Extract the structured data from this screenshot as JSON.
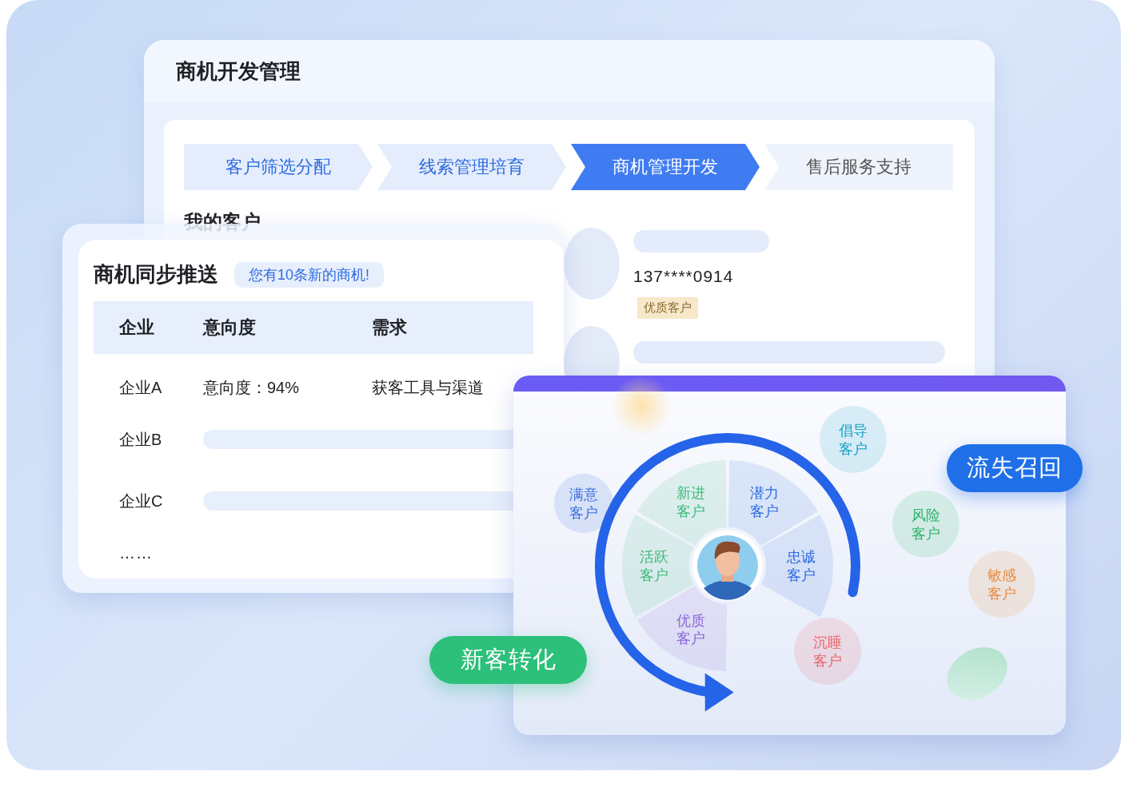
{
  "window": {
    "title": "商机开发管理"
  },
  "steps": [
    {
      "label": "客户筛选分配",
      "selected": false
    },
    {
      "label": "线索管理培育",
      "selected": false
    },
    {
      "label": "商机管理开发",
      "selected": true
    },
    {
      "label": "售后服务支持",
      "selected": false
    }
  ],
  "my_customers": {
    "title": "我的客户",
    "phone": "137****0914",
    "tag": "优质客户"
  },
  "push_card": {
    "title": "商机同步推送",
    "badge": "您有10条新的商机!",
    "columns": [
      "企业",
      "意向度",
      "需求"
    ],
    "rows": [
      {
        "company": "企业A",
        "intent": "意向度：94%",
        "need": "获客工具与渠道"
      },
      {
        "company": "企业B"
      },
      {
        "company": "企业C"
      }
    ],
    "more": "……"
  },
  "wheel": {
    "segments": [
      {
        "label": "优质客户",
        "color": "#8a66d6"
      },
      {
        "label": "活跃客户",
        "color": "#3dbb7a"
      },
      {
        "label": "新进客户",
        "color": "#3dbb7a"
      },
      {
        "label": "潜力客户",
        "color": "#2d6be0"
      },
      {
        "label": "忠诚客户",
        "color": "#2d6be0"
      }
    ],
    "bubbles": [
      {
        "label": "满意客户",
        "color": "#3e6fe0"
      },
      {
        "label": "倡导客户",
        "color": "#1aa0c8"
      },
      {
        "label": "风险客户",
        "color": "#2bb36a"
      },
      {
        "label": "敏感客户",
        "color": "#e98a3a"
      },
      {
        "label": "沉睡客户",
        "color": "#e8656b"
      }
    ]
  },
  "pills": [
    {
      "label": "流失召回",
      "color": "#1f6fe8"
    },
    {
      "label": "新客转化",
      "color": "#2cc07a"
    }
  ]
}
